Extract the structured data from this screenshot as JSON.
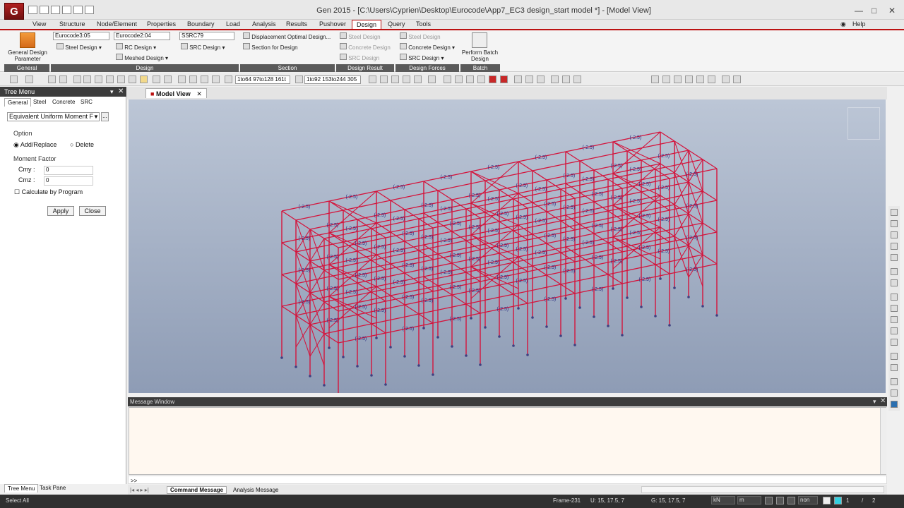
{
  "app": {
    "title": "Gen 2015 - [C:\\Users\\Cyprien\\Desktop\\Eurocode\\App7_EC3 design_start model *] - [Model View]",
    "logo": "G",
    "help": "Help"
  },
  "menu": [
    "View",
    "Structure",
    "Node/Element",
    "Properties",
    "Boundary",
    "Load",
    "Analysis",
    "Results",
    "Pushover",
    "Design",
    "Query",
    "Tools"
  ],
  "ribbon": {
    "general_param": "General Design Parameter",
    "steel_code": "Eurocode3:05",
    "steel_design": "Steel Design",
    "rc_code": "Eurocode2:04",
    "rc_design": "RC Design",
    "meshed_design": "Meshed Design",
    "src_code": "SSRC79",
    "src_design": "SRC Design",
    "disp_opt": "Displacement Optimal Design...",
    "section_design": "Section for Design",
    "res_steel": "Steel Design",
    "res_concrete": "Concrete Design",
    "res_src": "SRC Design",
    "f_steel": "Steel Design",
    "f_concrete": "Concrete Design",
    "f_src": "SRC Design",
    "perform_batch": "Perform Batch Design",
    "groups": {
      "general": "General",
      "design": "Design",
      "section": "Section",
      "result": "Design Result",
      "forces": "Design Forces",
      "batch": "Batch"
    }
  },
  "toolbar": {
    "sel1": "1to64 97to128 161t",
    "sel2": "1to92 153to244 305"
  },
  "tree": {
    "title": "Tree Menu",
    "tabs": [
      "General",
      "Steel",
      "Concrete",
      "SRC"
    ],
    "command": "Equivalent Uniform Moment F",
    "option_label": "Option",
    "add_replace": "Add/Replace",
    "delete": "Delete",
    "moment_factor": "Moment Factor",
    "cmy_label": "Cmy :",
    "cmy": "0",
    "cmz_label": "Cmz :",
    "cmz": "0",
    "calc_program": "Calculate by Program",
    "apply": "Apply",
    "close": "Close",
    "bottom_tabs": [
      "Tree Menu",
      "Task Pane"
    ]
  },
  "view": {
    "tab": "Model View",
    "member_label": "(-2.5)"
  },
  "message": {
    "title": "Message Window",
    "prompt": ">>",
    "tabs": [
      "Command Message",
      "Analysis Message"
    ]
  },
  "status": {
    "left": "Select All",
    "frame": "Frame-231",
    "ucs": "U: 15, 17.5, 7",
    "gcs": "G: 15, 17.5, 7",
    "force": "kN",
    "length": "m",
    "none": "non",
    "page": "1",
    "pages": "2"
  },
  "colors": {
    "frame": "#d4143c",
    "accent": "#b01020",
    "view_top": "#bcc6d6",
    "view_bottom": "#8e9cb5"
  }
}
